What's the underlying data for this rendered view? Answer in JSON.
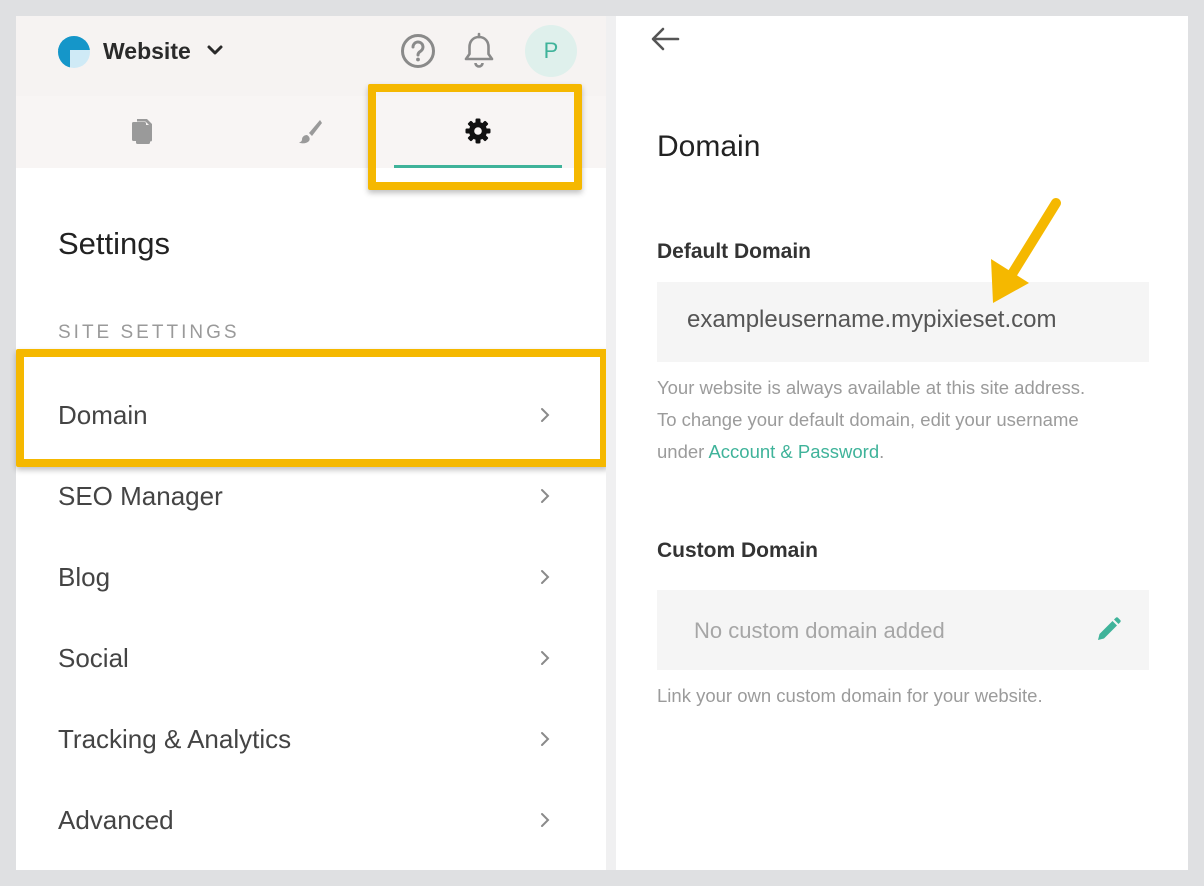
{
  "header": {
    "site_name": "Website",
    "avatar_initial": "P"
  },
  "tabs": [
    {
      "icon": "pages-icon",
      "active": false
    },
    {
      "icon": "brush-icon",
      "active": false
    },
    {
      "icon": "gear-icon",
      "active": true
    }
  ],
  "sidebar": {
    "title": "Settings",
    "section_label": "SITE SETTINGS",
    "items": [
      {
        "label": "Domain"
      },
      {
        "label": "SEO Manager"
      },
      {
        "label": "Blog"
      },
      {
        "label": "Social"
      },
      {
        "label": "Tracking & Analytics"
      },
      {
        "label": "Advanced"
      }
    ]
  },
  "domain_panel": {
    "title": "Domain",
    "default_domain": {
      "label": "Default Domain",
      "value": "exampleusername.mypixieset.com",
      "help_line1": "Your website is always available at this site address.",
      "help_line2": "To change your default domain, edit your username",
      "help_prefix": "under ",
      "help_link": "Account & Password",
      "help_suffix": "."
    },
    "custom_domain": {
      "label": "Custom Domain",
      "placeholder": "No custom domain added",
      "help": "Link your own custom domain for your website."
    }
  },
  "colors": {
    "accent": "#3fb39a",
    "highlight": "#f5b800",
    "logo_blue": "#1596c9"
  }
}
